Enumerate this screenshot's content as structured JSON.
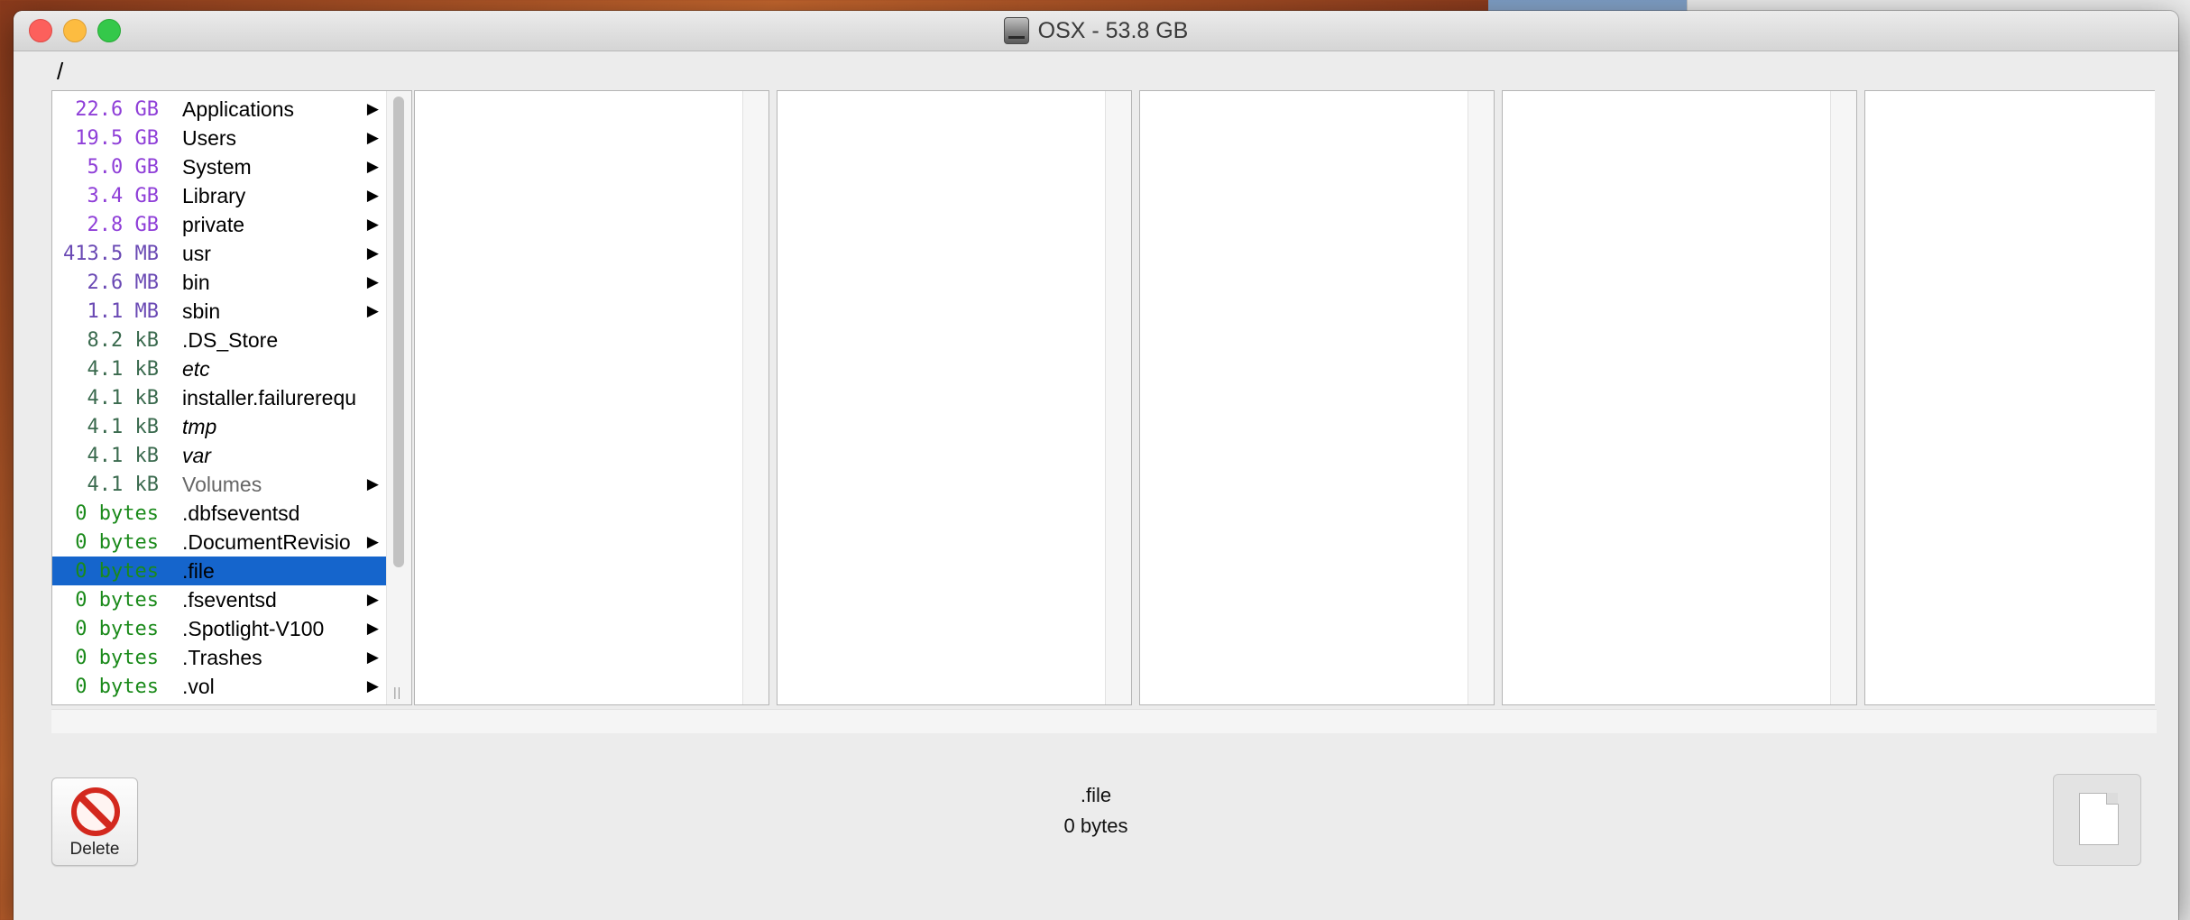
{
  "window": {
    "title": "OSX - 53.8 GB",
    "path": "/"
  },
  "colors": {
    "gb": "#8f3fd8",
    "mb": "#6a49b4",
    "kb": "#3a6a4e",
    "bytes": "#1a8a1a",
    "selection": "#1565cc"
  },
  "files": [
    {
      "size": "22.6 GB",
      "name": "Applications",
      "unit": "gb",
      "folder": true
    },
    {
      "size": "19.5 GB",
      "name": "Users",
      "unit": "gb",
      "folder": true
    },
    {
      "size": "5.0 GB",
      "name": "System",
      "unit": "gb",
      "folder": true
    },
    {
      "size": "3.4 GB",
      "name": "Library",
      "unit": "gb",
      "folder": true
    },
    {
      "size": "2.8 GB",
      "name": "private",
      "unit": "gb",
      "folder": true
    },
    {
      "size": "413.5 MB",
      "name": "usr",
      "unit": "mb",
      "folder": true
    },
    {
      "size": "2.6 MB",
      "name": "bin",
      "unit": "mb",
      "folder": true
    },
    {
      "size": "1.1 MB",
      "name": "sbin",
      "unit": "mb",
      "folder": true
    },
    {
      "size": "8.2 kB",
      "name": ".DS_Store",
      "unit": "kb",
      "folder": false
    },
    {
      "size": "4.1 kB",
      "name": "etc",
      "unit": "kb",
      "folder": false,
      "italic": true
    },
    {
      "size": "4.1 kB",
      "name": "installer.failurerequ",
      "unit": "kb",
      "folder": false
    },
    {
      "size": "4.1 kB",
      "name": "tmp",
      "unit": "kb",
      "folder": false,
      "italic": true
    },
    {
      "size": "4.1 kB",
      "name": "var",
      "unit": "kb",
      "folder": false,
      "italic": true
    },
    {
      "size": "4.1 kB",
      "name": "Volumes",
      "unit": "kb",
      "folder": true,
      "dim": true
    },
    {
      "size": "0 bytes",
      "name": ".dbfseventsd",
      "unit": "b",
      "folder": false
    },
    {
      "size": "0 bytes",
      "name": ".DocumentRevisio",
      "unit": "b",
      "folder": true
    },
    {
      "size": "0 bytes",
      "name": ".file",
      "unit": "b",
      "folder": false,
      "selected": true
    },
    {
      "size": "0 bytes",
      "name": ".fseventsd",
      "unit": "b",
      "folder": true
    },
    {
      "size": "0 bytes",
      "name": ".Spotlight-V100",
      "unit": "b",
      "folder": true
    },
    {
      "size": "0 bytes",
      "name": ".Trashes",
      "unit": "b",
      "folder": true
    },
    {
      "size": "0 bytes",
      "name": ".vol",
      "unit": "b",
      "folder": true
    }
  ],
  "footer": {
    "delete_label": "Delete",
    "selected_name": ".file",
    "selected_size": "0 bytes"
  },
  "icons": {
    "disk": "hard-disk-icon",
    "delete": "no-entry-icon",
    "document": "document-icon",
    "disclosure": "▶"
  }
}
